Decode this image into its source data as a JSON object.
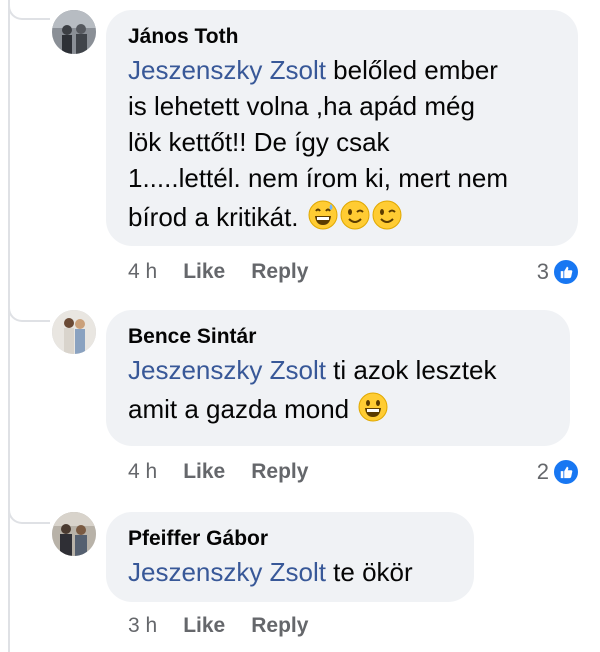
{
  "comments": [
    {
      "author": "János Toth",
      "mention": "Jeszenszky Zsolt",
      "text_line1": " belőled ember",
      "text_line2": "is lehetett volna  ,ha apád még",
      "text_line3": "lök kettőt!! De így csak",
      "text_line4": "1.....lettél. nem írom ki, mert nem",
      "text_line5": "bírod a kritikát. ",
      "emojis": [
        "grinning-sweat-emoji",
        "winking-emoji",
        "winking-emoji"
      ],
      "time": "4 h",
      "like_label": "Like",
      "reply_label": "Reply",
      "reaction_count": "3",
      "reaction_icon": "thumbs-up-icon"
    },
    {
      "author": "Bence Sintár",
      "mention": "Jeszenszky Zsolt",
      "text_line1": " ti azok lesztek",
      "text_line2": "amit a gazda mond ",
      "emojis": [
        "grinning-emoji"
      ],
      "time": "4 h",
      "like_label": "Like",
      "reply_label": "Reply",
      "reaction_count": "2",
      "reaction_icon": "thumbs-up-icon"
    },
    {
      "author": "Pfeiffer Gábor",
      "mention": "Jeszenszky Zsolt",
      "text_line1": " te ökör",
      "time": "3 h",
      "like_label": "Like",
      "reply_label": "Reply"
    }
  ],
  "colors": {
    "mention": "#385898",
    "bubble": "#f0f2f5",
    "meta": "#65676b",
    "like_badge": "#1877f2"
  }
}
